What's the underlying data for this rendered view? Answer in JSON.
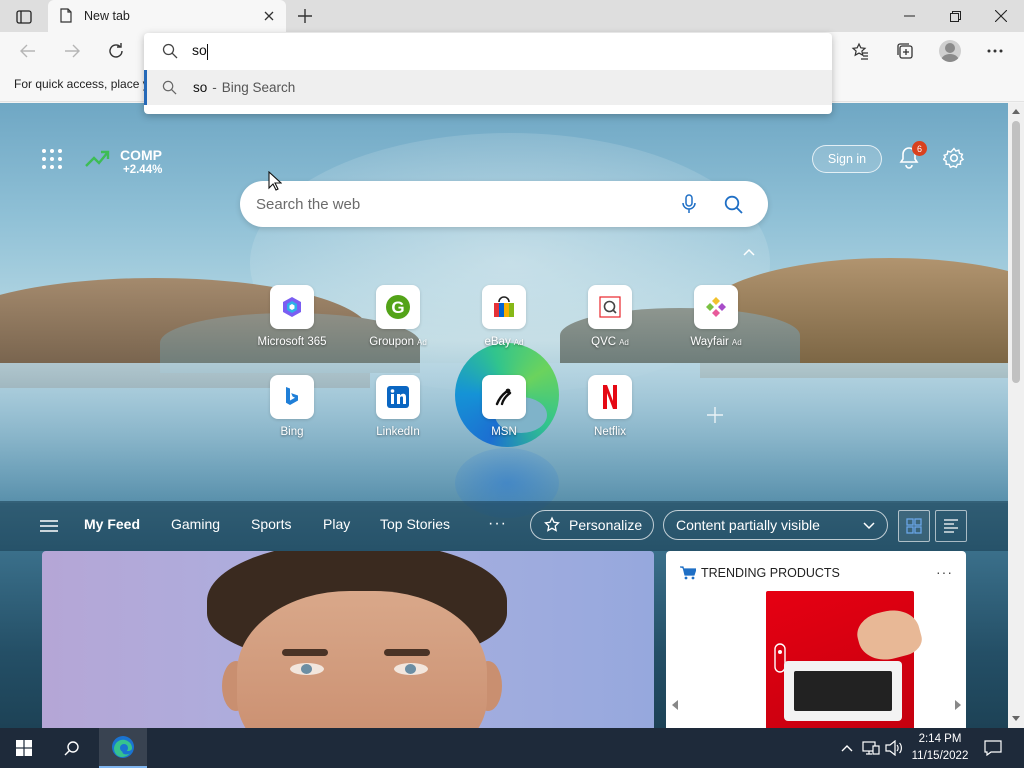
{
  "tab": {
    "title": "New tab"
  },
  "favorites_bar": {
    "text": "For quick access, place y"
  },
  "omnibox": {
    "value": "so",
    "suggestion": {
      "query": "so",
      "separator": "-",
      "engine": "Bing Search"
    }
  },
  "ntp": {
    "stock": {
      "symbol": "COMP",
      "change": "+2.44%"
    },
    "search_placeholder": "Search the web",
    "signin_label": "Sign in",
    "notification_count": "6",
    "tiles": [
      {
        "label": "Microsoft 365",
        "ad": "",
        "icon": "microsoft-365-icon"
      },
      {
        "label": "Groupon",
        "ad": "Ad",
        "icon": "groupon-icon"
      },
      {
        "label": "eBay",
        "ad": "Ad",
        "icon": "ebay-icon"
      },
      {
        "label": "QVC",
        "ad": "Ad",
        "icon": "qvc-icon"
      },
      {
        "label": "Wayfair",
        "ad": "Ad",
        "icon": "wayfair-icon"
      },
      {
        "label": "Bing",
        "ad": "",
        "icon": "bing-icon"
      },
      {
        "label": "LinkedIn",
        "ad": "",
        "icon": "linkedin-icon"
      },
      {
        "label": "MSN",
        "ad": "",
        "icon": "msn-icon"
      },
      {
        "label": "Netflix",
        "ad": "",
        "icon": "netflix-icon"
      }
    ]
  },
  "feed_nav": {
    "items": [
      "My Feed",
      "Gaming",
      "Sports",
      "Play",
      "Top Stories"
    ],
    "active": "My Feed",
    "more": "···",
    "personalize_label": "Personalize",
    "content_dropdown_value": "Content partially visible"
  },
  "trending": {
    "title": "TRENDING PRODUCTS",
    "more": "···"
  },
  "taskbar": {
    "time": "2:14 PM",
    "date": "11/15/2022"
  },
  "colors": {
    "accent": "#2569b8",
    "taskbar": "#1e2a3a",
    "badge": "#d9411e",
    "stock_up": "#3dbd55"
  }
}
